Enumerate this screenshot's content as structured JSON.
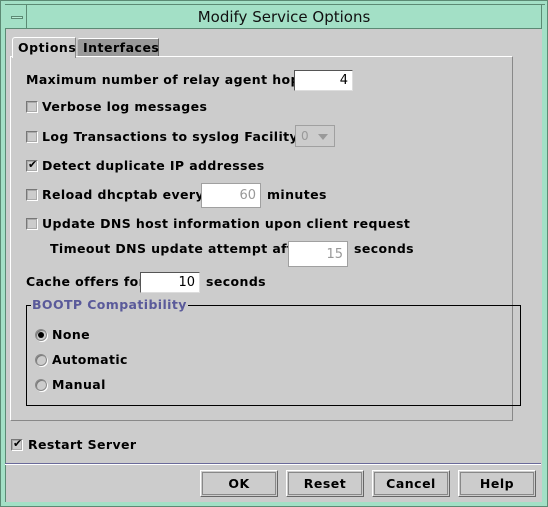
{
  "window": {
    "title": "Modify Service Options"
  },
  "tabs": [
    {
      "label": "Options",
      "selected": true
    },
    {
      "label": "Interfaces",
      "selected": false
    }
  ],
  "options": {
    "max_hops": {
      "label": "Maximum number of relay agent hops:",
      "value": "4"
    },
    "verbose": {
      "label": "Verbose log messages",
      "checked": false
    },
    "log_transactions": {
      "label": "Log Transactions to syslog Facility:",
      "checked": false,
      "facility_value": "0"
    },
    "detect_duplicate": {
      "label": "Detect duplicate IP addresses",
      "checked": true
    },
    "reload_dhcptab": {
      "label": "Reload dhcptab every",
      "checked": false,
      "value": "60",
      "unit": "minutes"
    },
    "update_dns": {
      "label": "Update DNS host information upon client request",
      "checked": false
    },
    "dns_timeout": {
      "label": "Timeout DNS update attempt after",
      "value": "15",
      "unit": "seconds"
    },
    "cache_offers": {
      "label": "Cache offers for",
      "value": "10",
      "unit": "seconds"
    },
    "bootp": {
      "title": "BOOTP Compatibility",
      "options": [
        {
          "label": "None",
          "selected": true
        },
        {
          "label": "Automatic",
          "selected": false
        },
        {
          "label": "Manual",
          "selected": false
        }
      ]
    }
  },
  "restart_server": {
    "label": "Restart Server",
    "checked": true
  },
  "buttons": {
    "ok": "OK",
    "reset": "Reset",
    "cancel": "Cancel",
    "help": "Help"
  },
  "check_glyph": "✔"
}
